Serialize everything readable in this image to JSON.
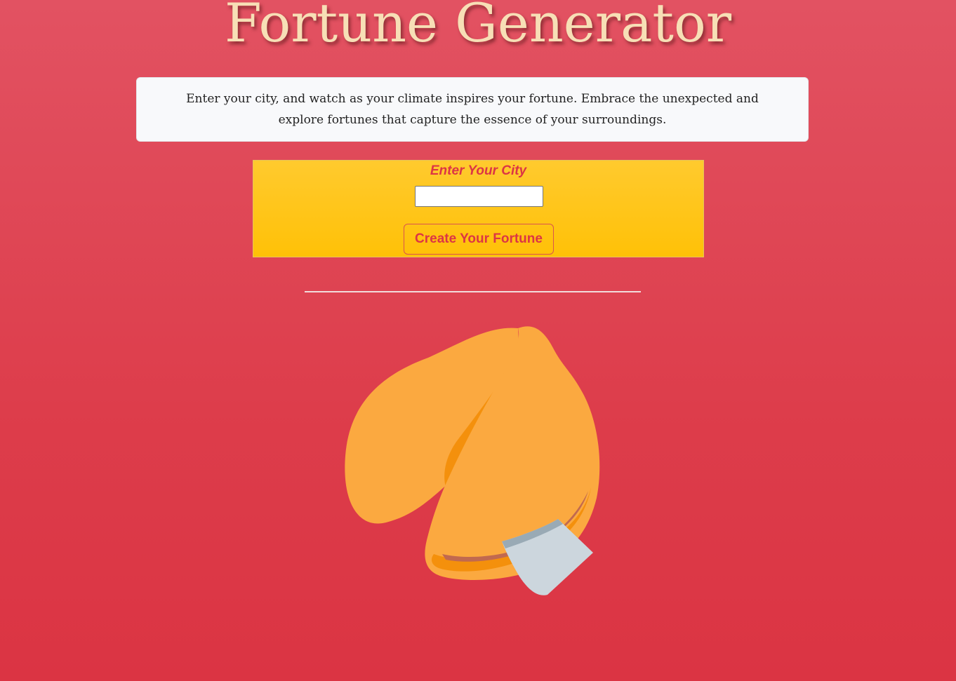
{
  "header": {
    "title": "Fortune Generator"
  },
  "intro": {
    "text": "Enter your city, and watch as your climate inspires your fortune. Embrace the unexpected and explore fortunes that capture the essence of your surroundings."
  },
  "form": {
    "city_label": "Enter Your City",
    "city_value": "",
    "city_placeholder": "",
    "submit_label": "Create Your Fortune"
  },
  "illustration": {
    "icon": "fortune-cookie-icon"
  },
  "colors": {
    "background_top": "#e25262",
    "background_bottom": "#db3443",
    "title": "#f7dfb6",
    "panel": "#ffc107",
    "accent": "#dc3545",
    "cookie": "#fba940",
    "cookie_shadow": "#f4900c",
    "paper": "#ccd6dd"
  }
}
